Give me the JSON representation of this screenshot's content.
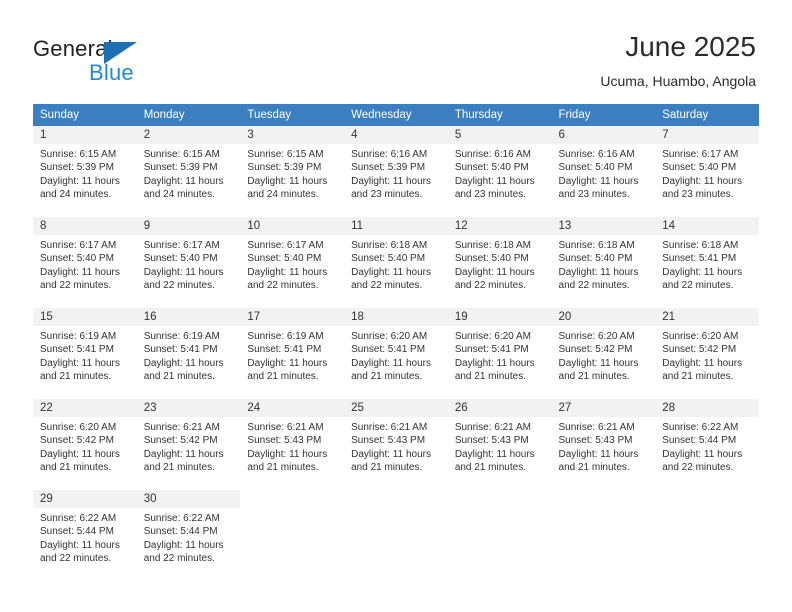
{
  "brand": {
    "word1": "General",
    "word2": "Blue",
    "triangle_color": "#1f6fb5",
    "blue_color": "#2389d4"
  },
  "header": {
    "title": "June 2025",
    "subtitle": "Ucuma, Huambo, Angola"
  },
  "theme": {
    "header_row_bg": "#3c7fc1",
    "daynum_bg": "#f2f2f2",
    "text": "#333333"
  },
  "calendar": {
    "weekday_headers": [
      "Sunday",
      "Monday",
      "Tuesday",
      "Wednesday",
      "Thursday",
      "Friday",
      "Saturday"
    ],
    "weeks": [
      [
        {
          "day": "1",
          "sunrise": "Sunrise: 6:15 AM",
          "sunset": "Sunset: 5:39 PM",
          "daylight1": "Daylight: 11 hours",
          "daylight2": "and 24 minutes."
        },
        {
          "day": "2",
          "sunrise": "Sunrise: 6:15 AM",
          "sunset": "Sunset: 5:39 PM",
          "daylight1": "Daylight: 11 hours",
          "daylight2": "and 24 minutes."
        },
        {
          "day": "3",
          "sunrise": "Sunrise: 6:15 AM",
          "sunset": "Sunset: 5:39 PM",
          "daylight1": "Daylight: 11 hours",
          "daylight2": "and 24 minutes."
        },
        {
          "day": "4",
          "sunrise": "Sunrise: 6:16 AM",
          "sunset": "Sunset: 5:39 PM",
          "daylight1": "Daylight: 11 hours",
          "daylight2": "and 23 minutes."
        },
        {
          "day": "5",
          "sunrise": "Sunrise: 6:16 AM",
          "sunset": "Sunset: 5:40 PM",
          "daylight1": "Daylight: 11 hours",
          "daylight2": "and 23 minutes."
        },
        {
          "day": "6",
          "sunrise": "Sunrise: 6:16 AM",
          "sunset": "Sunset: 5:40 PM",
          "daylight1": "Daylight: 11 hours",
          "daylight2": "and 23 minutes."
        },
        {
          "day": "7",
          "sunrise": "Sunrise: 6:17 AM",
          "sunset": "Sunset: 5:40 PM",
          "daylight1": "Daylight: 11 hours",
          "daylight2": "and 23 minutes."
        }
      ],
      [
        {
          "day": "8",
          "sunrise": "Sunrise: 6:17 AM",
          "sunset": "Sunset: 5:40 PM",
          "daylight1": "Daylight: 11 hours",
          "daylight2": "and 22 minutes."
        },
        {
          "day": "9",
          "sunrise": "Sunrise: 6:17 AM",
          "sunset": "Sunset: 5:40 PM",
          "daylight1": "Daylight: 11 hours",
          "daylight2": "and 22 minutes."
        },
        {
          "day": "10",
          "sunrise": "Sunrise: 6:17 AM",
          "sunset": "Sunset: 5:40 PM",
          "daylight1": "Daylight: 11 hours",
          "daylight2": "and 22 minutes."
        },
        {
          "day": "11",
          "sunrise": "Sunrise: 6:18 AM",
          "sunset": "Sunset: 5:40 PM",
          "daylight1": "Daylight: 11 hours",
          "daylight2": "and 22 minutes."
        },
        {
          "day": "12",
          "sunrise": "Sunrise: 6:18 AM",
          "sunset": "Sunset: 5:40 PM",
          "daylight1": "Daylight: 11 hours",
          "daylight2": "and 22 minutes."
        },
        {
          "day": "13",
          "sunrise": "Sunrise: 6:18 AM",
          "sunset": "Sunset: 5:40 PM",
          "daylight1": "Daylight: 11 hours",
          "daylight2": "and 22 minutes."
        },
        {
          "day": "14",
          "sunrise": "Sunrise: 6:18 AM",
          "sunset": "Sunset: 5:41 PM",
          "daylight1": "Daylight: 11 hours",
          "daylight2": "and 22 minutes."
        }
      ],
      [
        {
          "day": "15",
          "sunrise": "Sunrise: 6:19 AM",
          "sunset": "Sunset: 5:41 PM",
          "daylight1": "Daylight: 11 hours",
          "daylight2": "and 21 minutes."
        },
        {
          "day": "16",
          "sunrise": "Sunrise: 6:19 AM",
          "sunset": "Sunset: 5:41 PM",
          "daylight1": "Daylight: 11 hours",
          "daylight2": "and 21 minutes."
        },
        {
          "day": "17",
          "sunrise": "Sunrise: 6:19 AM",
          "sunset": "Sunset: 5:41 PM",
          "daylight1": "Daylight: 11 hours",
          "daylight2": "and 21 minutes."
        },
        {
          "day": "18",
          "sunrise": "Sunrise: 6:20 AM",
          "sunset": "Sunset: 5:41 PM",
          "daylight1": "Daylight: 11 hours",
          "daylight2": "and 21 minutes."
        },
        {
          "day": "19",
          "sunrise": "Sunrise: 6:20 AM",
          "sunset": "Sunset: 5:41 PM",
          "daylight1": "Daylight: 11 hours",
          "daylight2": "and 21 minutes."
        },
        {
          "day": "20",
          "sunrise": "Sunrise: 6:20 AM",
          "sunset": "Sunset: 5:42 PM",
          "daylight1": "Daylight: 11 hours",
          "daylight2": "and 21 minutes."
        },
        {
          "day": "21",
          "sunrise": "Sunrise: 6:20 AM",
          "sunset": "Sunset: 5:42 PM",
          "daylight1": "Daylight: 11 hours",
          "daylight2": "and 21 minutes."
        }
      ],
      [
        {
          "day": "22",
          "sunrise": "Sunrise: 6:20 AM",
          "sunset": "Sunset: 5:42 PM",
          "daylight1": "Daylight: 11 hours",
          "daylight2": "and 21 minutes."
        },
        {
          "day": "23",
          "sunrise": "Sunrise: 6:21 AM",
          "sunset": "Sunset: 5:42 PM",
          "daylight1": "Daylight: 11 hours",
          "daylight2": "and 21 minutes."
        },
        {
          "day": "24",
          "sunrise": "Sunrise: 6:21 AM",
          "sunset": "Sunset: 5:43 PM",
          "daylight1": "Daylight: 11 hours",
          "daylight2": "and 21 minutes."
        },
        {
          "day": "25",
          "sunrise": "Sunrise: 6:21 AM",
          "sunset": "Sunset: 5:43 PM",
          "daylight1": "Daylight: 11 hours",
          "daylight2": "and 21 minutes."
        },
        {
          "day": "26",
          "sunrise": "Sunrise: 6:21 AM",
          "sunset": "Sunset: 5:43 PM",
          "daylight1": "Daylight: 11 hours",
          "daylight2": "and 21 minutes."
        },
        {
          "day": "27",
          "sunrise": "Sunrise: 6:21 AM",
          "sunset": "Sunset: 5:43 PM",
          "daylight1": "Daylight: 11 hours",
          "daylight2": "and 21 minutes."
        },
        {
          "day": "28",
          "sunrise": "Sunrise: 6:22 AM",
          "sunset": "Sunset: 5:44 PM",
          "daylight1": "Daylight: 11 hours",
          "daylight2": "and 22 minutes."
        }
      ],
      [
        {
          "day": "29",
          "sunrise": "Sunrise: 6:22 AM",
          "sunset": "Sunset: 5:44 PM",
          "daylight1": "Daylight: 11 hours",
          "daylight2": "and 22 minutes."
        },
        {
          "day": "30",
          "sunrise": "Sunrise: 6:22 AM",
          "sunset": "Sunset: 5:44 PM",
          "daylight1": "Daylight: 11 hours",
          "daylight2": "and 22 minutes."
        },
        {
          "day": "",
          "sunrise": "",
          "sunset": "",
          "daylight1": "",
          "daylight2": ""
        },
        {
          "day": "",
          "sunrise": "",
          "sunset": "",
          "daylight1": "",
          "daylight2": ""
        },
        {
          "day": "",
          "sunrise": "",
          "sunset": "",
          "daylight1": "",
          "daylight2": ""
        },
        {
          "day": "",
          "sunrise": "",
          "sunset": "",
          "daylight1": "",
          "daylight2": ""
        },
        {
          "day": "",
          "sunrise": "",
          "sunset": "",
          "daylight1": "",
          "daylight2": ""
        }
      ]
    ]
  }
}
